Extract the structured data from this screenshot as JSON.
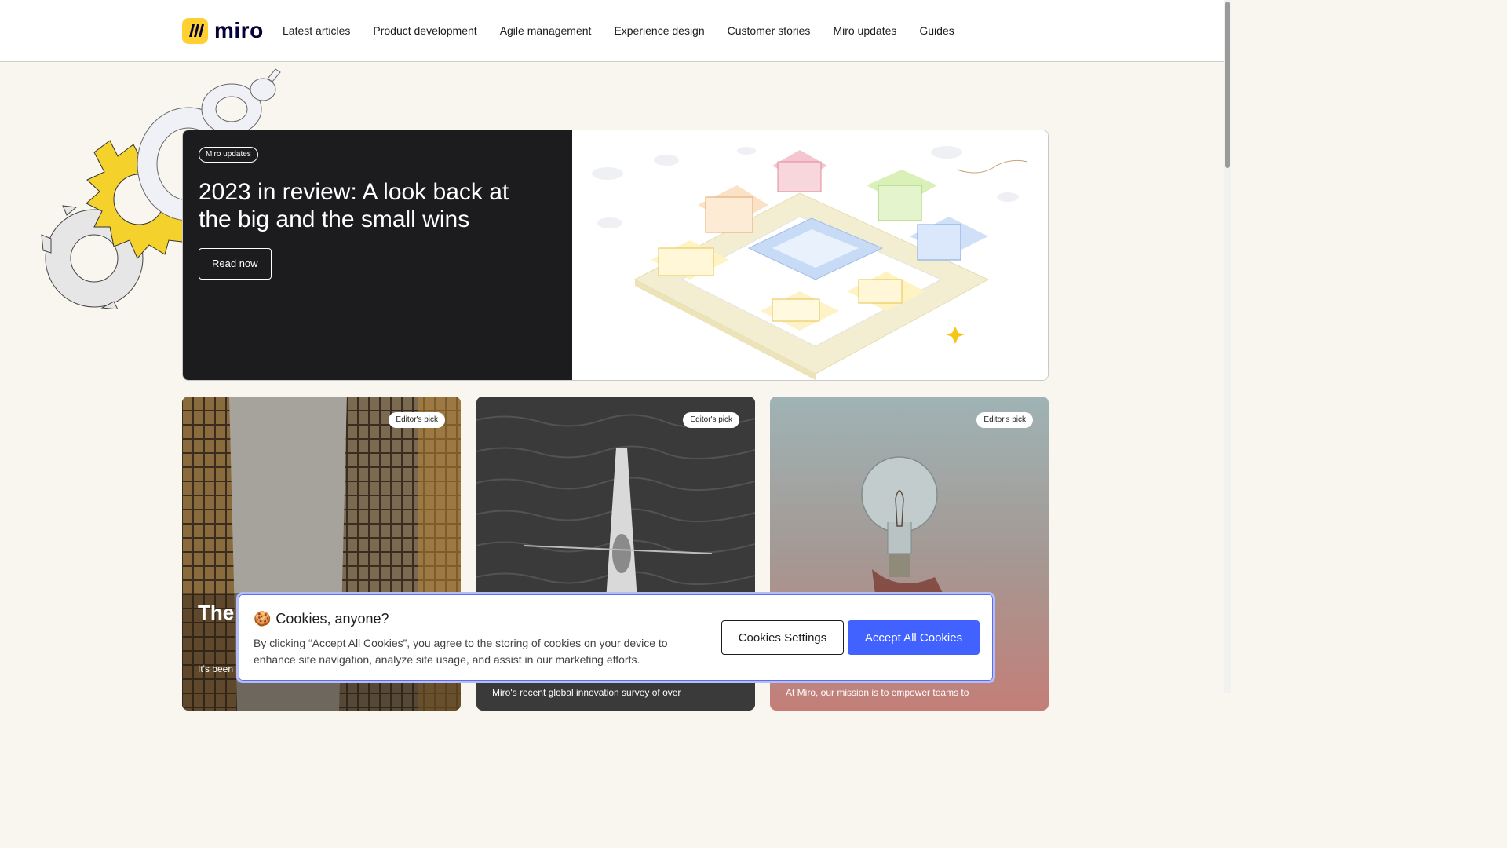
{
  "header": {
    "logo_text": "miro",
    "nav": [
      "Latest articles",
      "Product development",
      "Agile management",
      "Experience design",
      "Customer stories",
      "Miro updates",
      "Guides"
    ]
  },
  "hero": {
    "tag": "Miro updates",
    "title": "2023 in review: A look back at the big and the small wins",
    "cta": "Read now"
  },
  "cards": [
    {
      "tag": "Editor's pick",
      "title": "The Free",
      "excerpt": "It's been acquisition of Freehand, and I want ..."
    },
    {
      "tag": "Editor's pick",
      "title": "",
      "excerpt": "Miro's recent global innovation survey of over"
    },
    {
      "tag": "Editor's pick",
      "title": "",
      "excerpt": "At Miro, our mission is to empower teams to"
    }
  ],
  "cookie": {
    "emoji": "🍪",
    "title": "Cookies, anyone?",
    "text": "By clicking “Accept All Cookies”, you agree to the storing of cookies on your device to enhance site navigation, analyze site usage, and assist in our marketing efforts.",
    "settings_label": "Cookies Settings",
    "accept_label": "Accept All Cookies"
  },
  "colors": {
    "brand_yellow": "#ffd02f",
    "accent_blue": "#4262ff",
    "page_bg": "#f9f6f0",
    "hero_dark": "#1c1c1e"
  }
}
